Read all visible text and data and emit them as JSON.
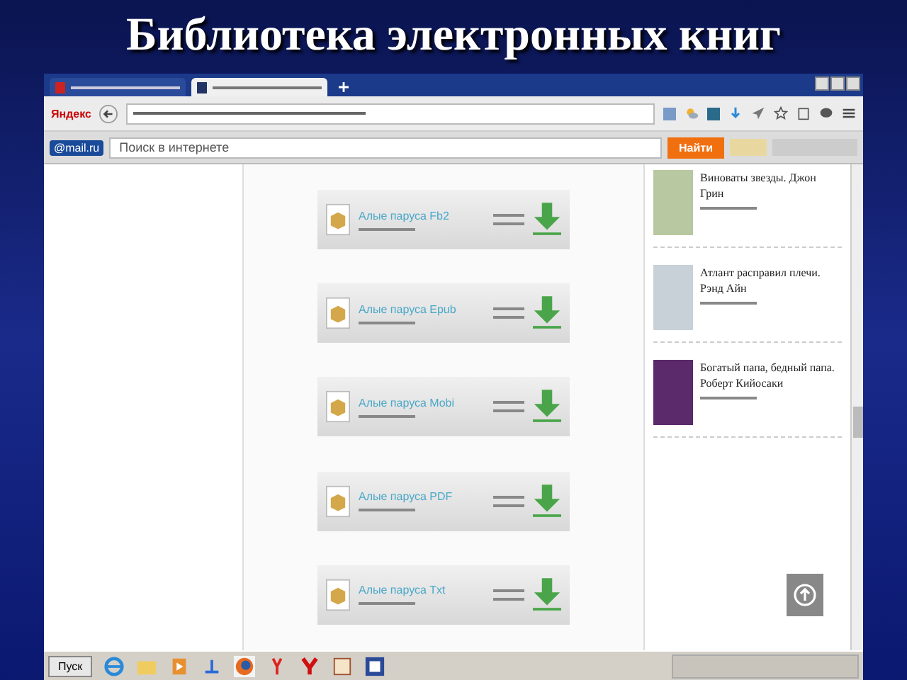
{
  "slide": {
    "title": "Библиотека электронных книг"
  },
  "browser": {
    "tabs": [
      {
        "selected": false
      },
      {
        "selected": true
      }
    ],
    "address_bar": {
      "logo": "Яндекс"
    },
    "search_bar": {
      "logo": "@mail.ru",
      "placeholder": "Поиск в интернете",
      "button": "Найти"
    },
    "downloads": [
      {
        "title": "Алые паруса Fb2"
      },
      {
        "title": "Алые паруса Epub"
      },
      {
        "title": "Алые паруса Mobi"
      },
      {
        "title": "Алые паруса PDF"
      },
      {
        "title": "Алые паруса Txt"
      }
    ],
    "sidebar": {
      "books": [
        {
          "title": "Виноваты звезды. Джон Грин"
        },
        {
          "title": "Атлант расправил плечи. Рэнд Айн"
        },
        {
          "title": "Богатый папа, бедный папа. Роберт Кийосаки"
        }
      ]
    }
  },
  "taskbar": {
    "start": "Пуск"
  }
}
